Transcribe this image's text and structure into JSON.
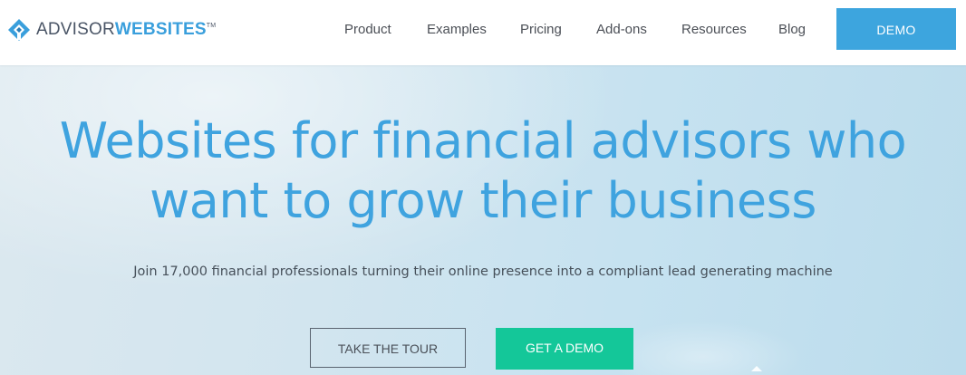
{
  "header": {
    "logo": {
      "text_regular": "ADVISOR",
      "text_bold": "WEBSITES",
      "trademark": "TM"
    },
    "nav": [
      {
        "label": "Product"
      },
      {
        "label": "Examples"
      },
      {
        "label": "Pricing"
      },
      {
        "label": "Add-ons"
      },
      {
        "label": "Resources"
      },
      {
        "label": "Blog"
      }
    ],
    "demo_label": "DEMO"
  },
  "hero": {
    "title_line1": "Websites for financial advisors who",
    "title_line2": "want to grow their business",
    "subtitle": "Join 17,000 financial professionals turning their online presence into a compliant lead generating machine",
    "tour_label": "TAKE THE TOUR",
    "get_demo_label": "GET A DEMO"
  },
  "colors": {
    "brand_blue": "#3da5de",
    "accent_green": "#14c799",
    "text_dark": "#4b4f56"
  }
}
